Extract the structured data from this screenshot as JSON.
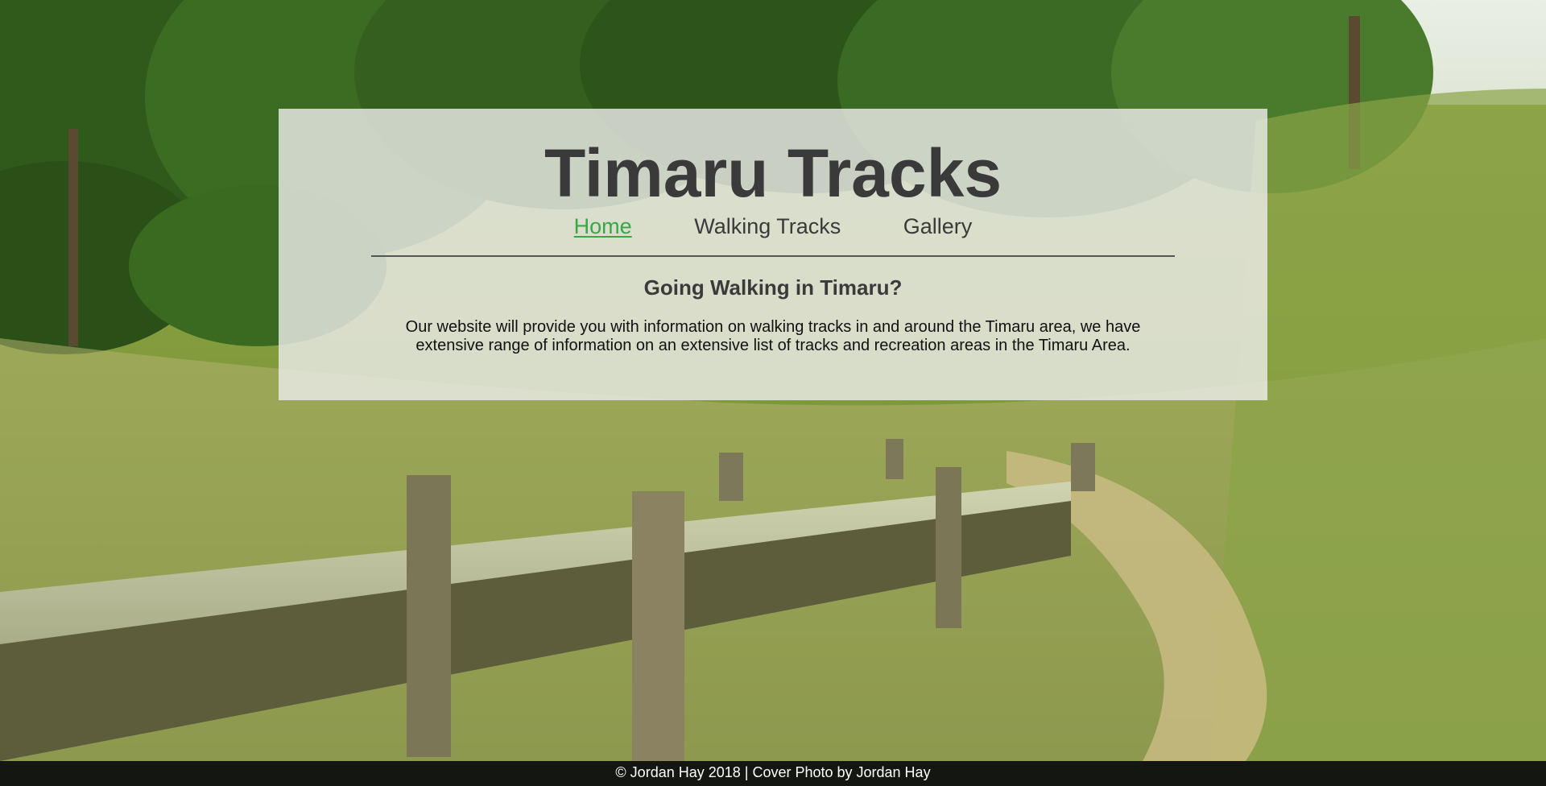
{
  "header": {
    "title": "Timaru Tracks"
  },
  "nav": {
    "items": [
      {
        "label": "Home",
        "active": true
      },
      {
        "label": "Walking Tracks",
        "active": false
      },
      {
        "label": "Gallery",
        "active": false
      }
    ]
  },
  "intro": {
    "heading": "Going Walking in Timaru?",
    "text": "Our website will provide you with information on walking tracks in and around the Timaru area, we have extensive range of information on an extensive list of tracks and recreation areas in the Timaru Area."
  },
  "footer": {
    "text": "© Jordan Hay 2018 | Cover Photo by Jordan Hay"
  },
  "colors": {
    "active_link": "#3aa64a",
    "text": "#3a3a3a",
    "footer_bg": "#141612"
  }
}
